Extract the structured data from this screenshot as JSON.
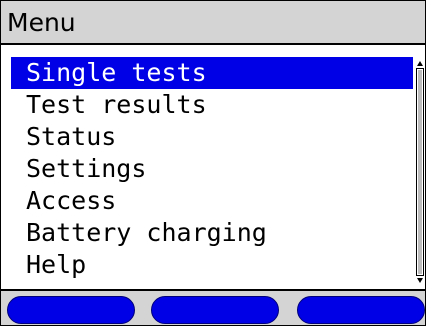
{
  "title": "Menu",
  "menu": {
    "selected_index": 0,
    "items": [
      {
        "label": "Single tests"
      },
      {
        "label": "Test results"
      },
      {
        "label": "Status"
      },
      {
        "label": "Settings"
      },
      {
        "label": "Access"
      },
      {
        "label": "Battery charging"
      },
      {
        "label": "Help"
      }
    ]
  },
  "softkeys": [
    {
      "label": ""
    },
    {
      "label": ""
    },
    {
      "label": ""
    }
  ],
  "colors": {
    "selection": "#0000e6",
    "bar_background": "#d4d4d4",
    "softkey": "#0000e6"
  }
}
